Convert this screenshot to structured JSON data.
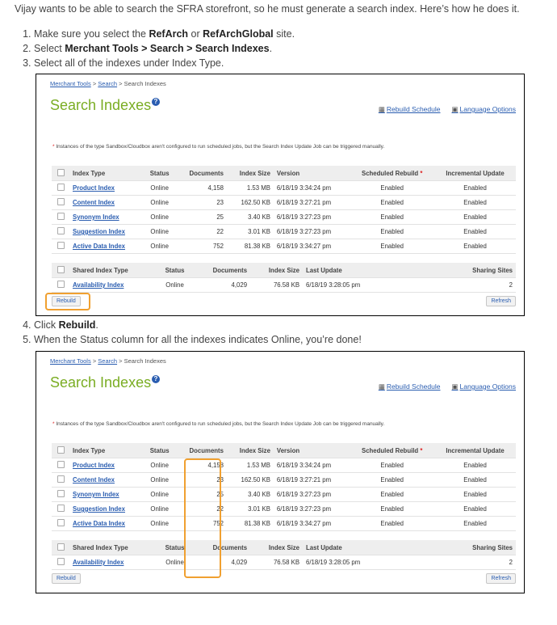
{
  "intro": "Vijay wants to be able to search the SFRA storefront, so he must generate a search index. Here’s how he does it.",
  "steps_a": [
    {
      "num": "1.",
      "pre": "Make sure you select the ",
      "b1": "RefArch",
      "mid": " or ",
      "b2": "RefArchGlobal",
      "post": " site."
    },
    {
      "num": "2.",
      "pre": "Select ",
      "b1": "Merchant Tools > Search > Search Indexes",
      "mid": "",
      "b2": "",
      "post": "."
    },
    {
      "num": "3.",
      "pre": "Select all of the indexes under Index Type.",
      "b1": "",
      "mid": "",
      "b2": "",
      "post": ""
    }
  ],
  "steps_b": [
    {
      "num": "4.",
      "pre": "Click ",
      "b1": "Rebuild",
      "mid": "",
      "b2": "",
      "post": "."
    },
    {
      "num": "5.",
      "pre": "When the Status column for all the indexes indicates Online, you’re done!",
      "b1": "",
      "mid": "",
      "b2": "",
      "post": ""
    }
  ],
  "screen": {
    "crumbs": [
      "Merchant Tools",
      "Search"
    ],
    "crumb_sep": ">",
    "crumb_current": "Search Indexes",
    "title": "Search Indexes",
    "help": "?",
    "rebuild_schedule": "Rebuild Schedule",
    "language_options": "Language Options",
    "note": "Instances of the type Sandbox/Cloudbox aren't configured to run scheduled jobs, but the Search Index Update Job can be triggered manually.",
    "note_ast": "*",
    "headers": [
      "Index Type",
      "Status",
      "Documents",
      "Index Size",
      "Version",
      "Scheduled Rebuild",
      "Incremental Update"
    ],
    "rows": [
      {
        "name": "Product Index",
        "status": "Online",
        "docs": "4,158",
        "size": "1.53 MB",
        "version": "6/18/19 3:34:24 pm",
        "sched": "Enabled",
        "incr": "Enabled"
      },
      {
        "name": "Content Index",
        "status": "Online",
        "docs": "23",
        "size": "162.50 KB",
        "version": "6/18/19 3:27:21 pm",
        "sched": "Enabled",
        "incr": "Enabled"
      },
      {
        "name": "Synonym Index",
        "status": "Online",
        "docs": "25",
        "size": "3.40 KB",
        "version": "6/18/19 3:27:23 pm",
        "sched": "Enabled",
        "incr": "Enabled"
      },
      {
        "name": "Suggestion Index",
        "status": "Online",
        "docs": "22",
        "size": "3.01 KB",
        "version": "6/18/19 3:27:23 pm",
        "sched": "Enabled",
        "incr": "Enabled"
      },
      {
        "name": "Active Data Index",
        "status": "Online",
        "docs": "752",
        "size": "81.38 KB",
        "version": "6/18/19 3:34:27 pm",
        "sched": "Enabled",
        "incr": "Enabled"
      }
    ],
    "shared_headers": [
      "Shared Index Type",
      "Status",
      "Documents",
      "Index Size",
      "Last Update",
      "Sharing Sites"
    ],
    "shared_rows": [
      {
        "name": "Availability Index",
        "status": "Online",
        "docs": "4,029",
        "size": "76.58 KB",
        "update": "6/18/19 3:28:05 pm",
        "sites": "2"
      }
    ],
    "rebuild_btn": "Rebuild",
    "refresh_btn": "Refresh"
  },
  "colors": {
    "title": "#7aad23",
    "link": "#2a5db0",
    "highlight": "#f0a030"
  }
}
